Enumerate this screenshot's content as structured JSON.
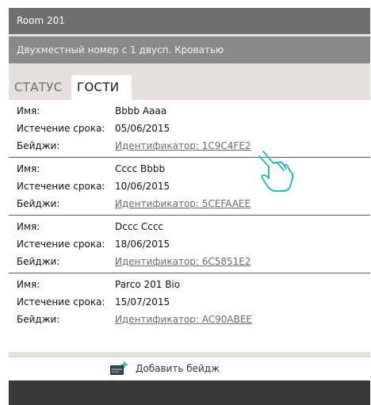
{
  "header": {
    "title": "Room 201",
    "subtitle": "Двухместный номер с 1 двусп. Кроватью"
  },
  "tabs": [
    {
      "label": "СТАТУС",
      "active": false
    },
    {
      "label": "ГОСТИ",
      "active": true
    }
  ],
  "labels": {
    "name": "Имя:",
    "expiry": "Истечение срока:",
    "badges": "Бейджи:"
  },
  "guests": [
    {
      "name": "Bbbb Aaaa",
      "expiry": "05/06/2015",
      "badge": "Идентификатор: 1C9C4FE2"
    },
    {
      "name": "Cccc Bbbb",
      "expiry": "10/06/2015",
      "badge": "Идентификатор: 5CEFAAEE"
    },
    {
      "name": "Dccc Cccc",
      "expiry": "18/06/2015",
      "badge": "Идентификатор: 6C5851E2"
    },
    {
      "name": "Parco 201 Bio",
      "expiry": "15/07/2015",
      "badge": "Идентификатор: AC90ABEE"
    }
  ],
  "footer": {
    "add_badge_label": "Добавить бейдж",
    "add_badge_icon": "card-add-icon"
  },
  "overlay": {
    "pointer_icon": "hand-pointer-icon"
  },
  "colors": {
    "title_bar": "#6f6f6f",
    "subtitle_bar": "#8a8a8a",
    "background": "#e4e0dc",
    "link": "#6a6a6a",
    "bottom_bar": "#383838",
    "icon_accent": "#2fb8b0"
  }
}
